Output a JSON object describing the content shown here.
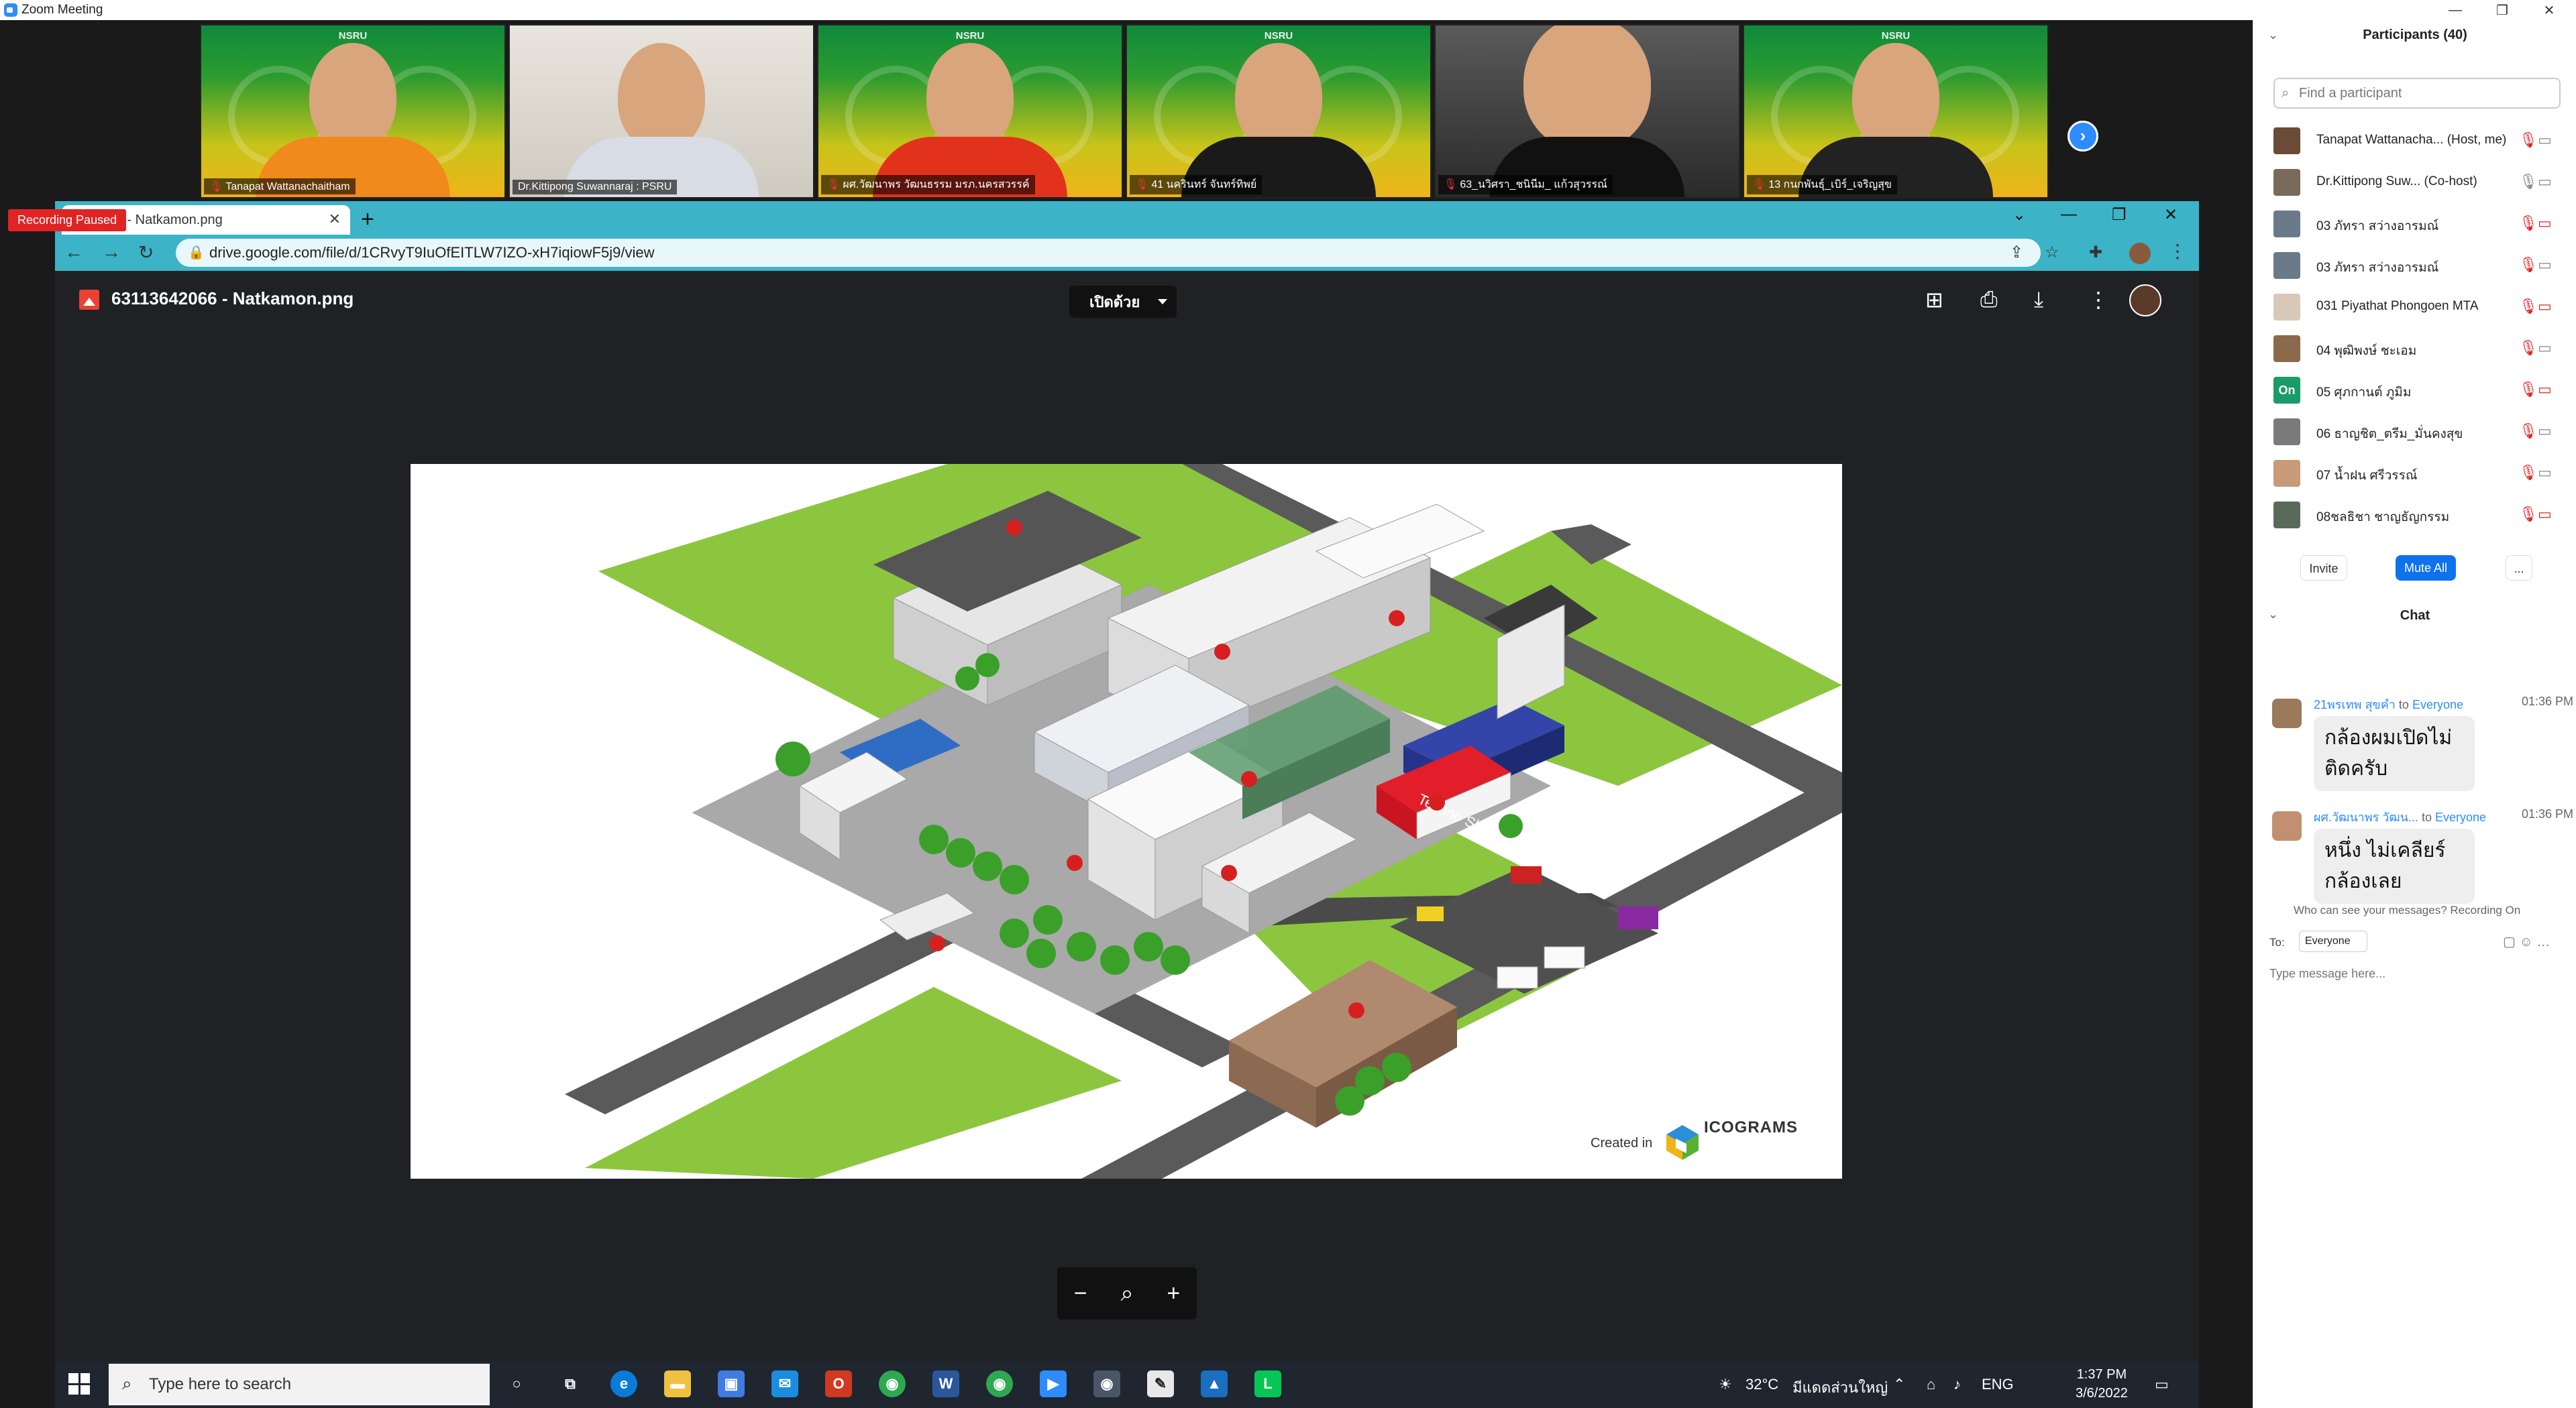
{
  "zoom": {
    "title": "Zoom Meeting",
    "recording_status": "Recording Paused"
  },
  "videos": [
    {
      "name": "Tanapat Wattanachaitham",
      "brand": "NSRU"
    },
    {
      "name": "Dr.Kittipong Suwannaraj : PSRU",
      "brand": ""
    },
    {
      "name": "ผศ.วัฒนาพร วัฒนธรรม มรภ.นครสวรรค์",
      "brand": "NSRU"
    },
    {
      "name": "41 นครินทร์ จันทร์ทิพย์",
      "brand": "NSRU"
    },
    {
      "name": "63_นวิศรา_ชนินีม_ แก้วสุวรรณ์",
      "brand": ""
    },
    {
      "name": "13 กนกพันธุ์_เบิร์_เจริญสุข",
      "brand": "NSRU"
    }
  ],
  "browser": {
    "tab_title": "3642066 - Natkamon.png",
    "url": "drive.google.com/file/d/1CRvyT9IuOfEITLW7IZO-xH7iqiowF5j9/view",
    "file_name": "63113642066 - Natkamon.png",
    "open_with": "เปิดด้วย",
    "created_in": "Created in",
    "logo_text": "ICOGRAMS",
    "map_labels": {
      "techno_shop": "Techno Shop"
    }
  },
  "taskbar": {
    "search_placeholder": "Type here to search",
    "weather": "32°C",
    "weather_text": "มีแดดส่วนใหญ่",
    "language": "ENG",
    "time": "1:37 PM",
    "date": "3/6/2022"
  },
  "participants": {
    "header": "Participants (40)",
    "find_placeholder": "Find a participant",
    "list": [
      {
        "name": "Tanapat Wattanacha...  (Host, me)",
        "mic": "muted",
        "cam": "on"
      },
      {
        "name": "Dr.Kittipong Suw... (Co-host)",
        "mic": "on",
        "cam": "on"
      },
      {
        "name": "03 ภัทรา สว่างอารมณ์",
        "mic": "muted",
        "cam": "off"
      },
      {
        "name": "03 ภัทรา สว่างอารมณ์",
        "mic": "muted",
        "cam": "on"
      },
      {
        "name": "031 Piyathat Phongoen MTA",
        "mic": "muted",
        "cam": "off"
      },
      {
        "name": "04 พุฒิพงษ์ ชะเอม",
        "mic": "muted",
        "cam": "on"
      },
      {
        "name": "05 ศุภกานต์ ภูมิม",
        "mic": "muted",
        "cam": "off",
        "initials": "On"
      },
      {
        "name": "06 ธาญชิต_ตรีม_มั่นคงสุข",
        "mic": "muted",
        "cam": "on"
      },
      {
        "name": "07 น้ำฝน ศรีวรรณ์",
        "mic": "muted",
        "cam": "on"
      },
      {
        "name": "08ชลธิชา ชาญธัญกรรม",
        "mic": "muted",
        "cam": "off"
      }
    ],
    "invite_label": "Invite",
    "mute_all_label": "Mute All",
    "more_label": "..."
  },
  "chat": {
    "header": "Chat",
    "messages": [
      {
        "from": "21พรเทพ สุขคำ",
        "to": "Everyone",
        "time": "01:36 PM",
        "text": "กล้องผมเปิดไม่ติดครับ"
      },
      {
        "from": "ผศ.วัฒนาพร วัฒน...",
        "to": "Everyone",
        "time": "01:36 PM",
        "text": "หนึ่ง ไม่เคลียร์กล้องเลย"
      }
    ],
    "to_word": "to",
    "visibility_note": "Who can see your messages? Recording On",
    "to_label": "To:",
    "to_value": "Everyone",
    "input_placeholder": "Type message here..."
  }
}
